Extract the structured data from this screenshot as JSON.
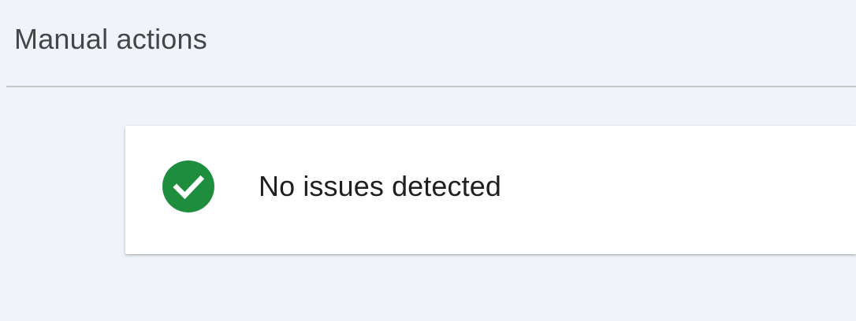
{
  "header": {
    "title": "Manual actions"
  },
  "status_card": {
    "icon": "check-circle-icon",
    "message": "No issues detected"
  },
  "colors": {
    "background": "#f0f3fa",
    "success": "#1e8e3e",
    "title_text": "#444746",
    "message_text": "#1f1f1f"
  }
}
